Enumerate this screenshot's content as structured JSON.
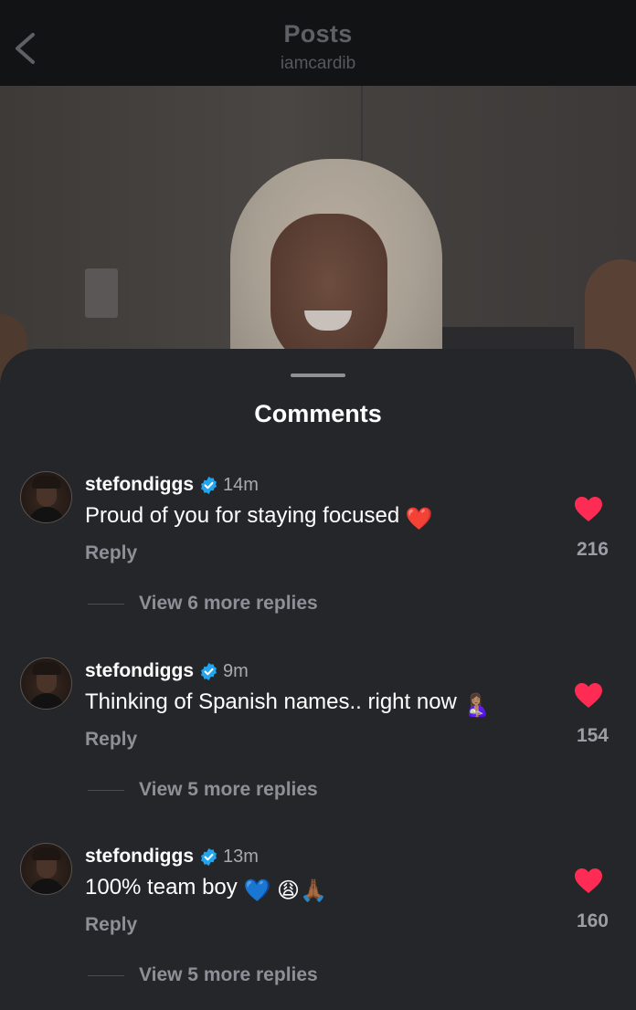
{
  "header": {
    "title": "Posts",
    "subtitle": "iamcardib"
  },
  "sheet": {
    "title": "Comments"
  },
  "colors": {
    "like": "#fe2c55",
    "verified": "#20a5f0"
  },
  "comments": [
    {
      "username": "stefondiggs",
      "time": "14m",
      "text": "Proud of you for staying focused",
      "emoji": "❤️",
      "reply_label": "Reply",
      "likes": "216",
      "view_more": "View 6 more replies"
    },
    {
      "username": "stefondiggs",
      "time": "9m",
      "text": "Thinking of Spanish names.. right now",
      "emoji": "🤱🏽",
      "reply_label": "Reply",
      "likes": "154",
      "view_more": "View 5 more replies"
    },
    {
      "username": "stefondiggs",
      "time": "13m",
      "text": "100% team boy",
      "emoji": "💙 😩🙏🏾",
      "reply_label": "Reply",
      "likes": "160",
      "view_more": "View 5 more replies"
    }
  ]
}
